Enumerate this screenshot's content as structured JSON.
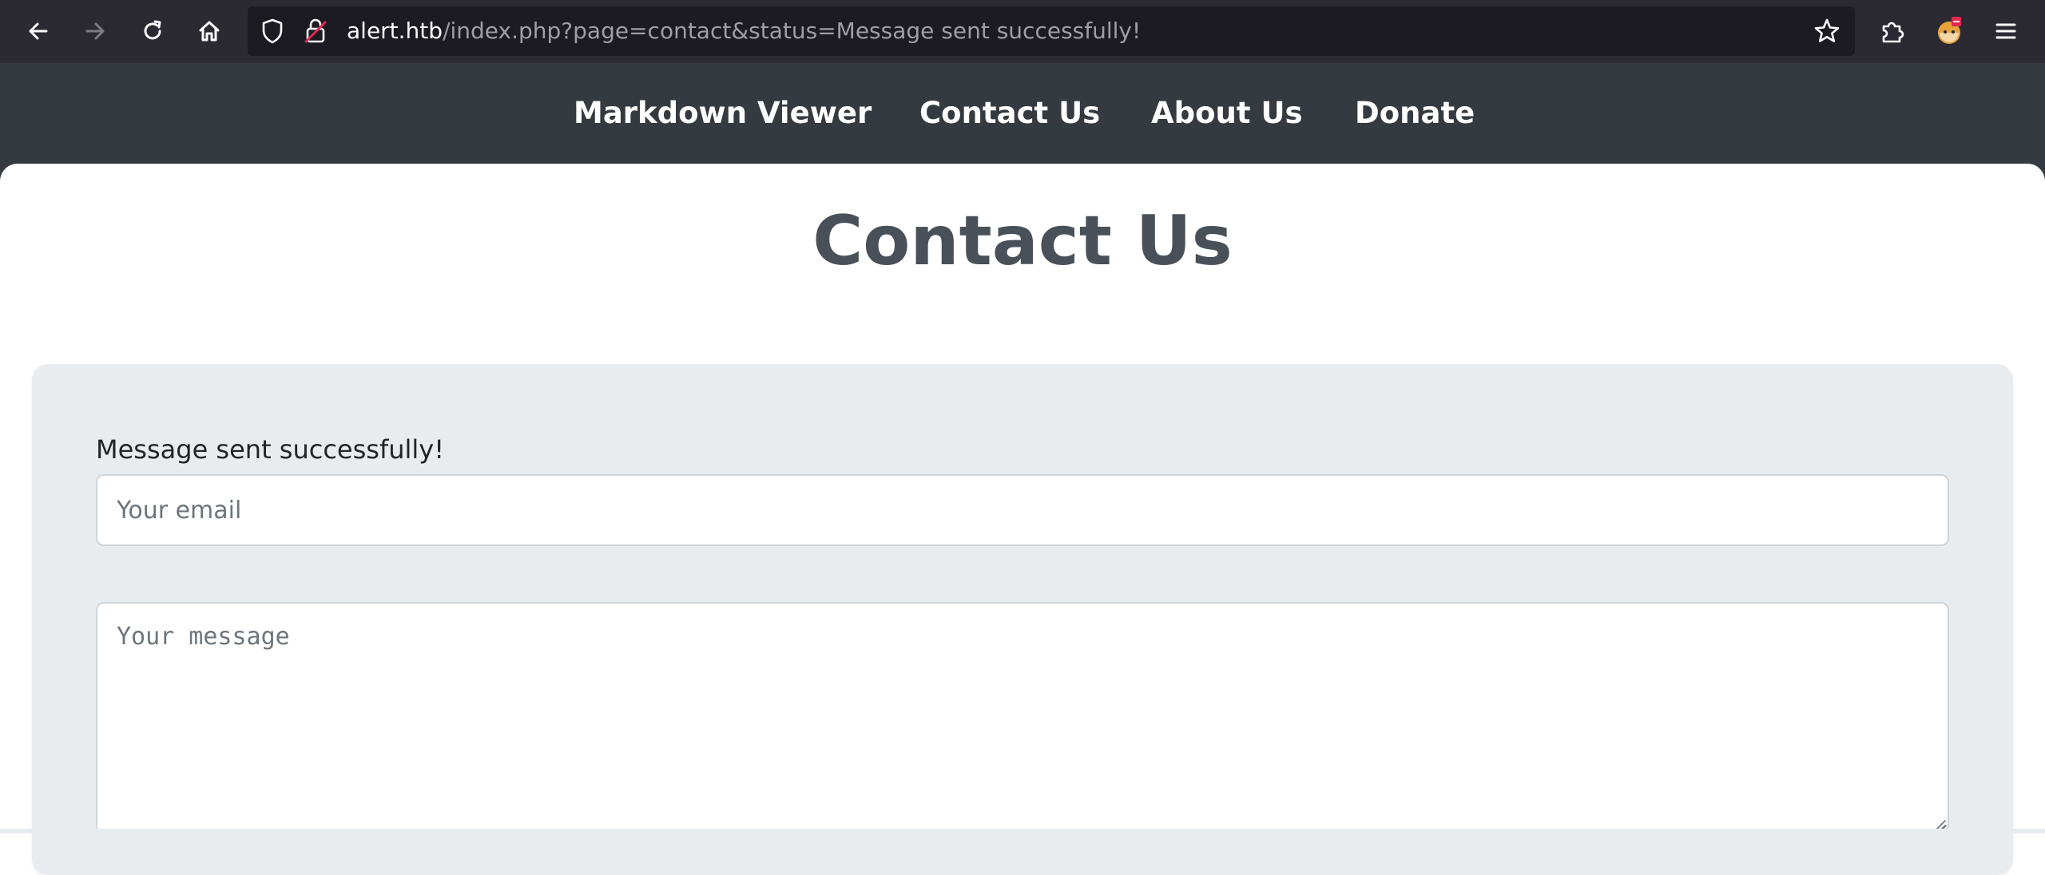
{
  "browser": {
    "url_host": "alert.htb",
    "url_path": "/index.php?page=contact&status=Message sent successfully!",
    "icons": [
      "back-arrow-icon",
      "forward-arrow-icon",
      "reload-icon",
      "home-icon",
      "shield-icon",
      "insecure-lock-icon",
      "bookmark-star-icon",
      "extensions-icon",
      "profile-avatar-icon",
      "hamburger-menu-icon"
    ]
  },
  "site_nav": {
    "items": [
      {
        "label": "Markdown Viewer"
      },
      {
        "label": "Contact Us"
      },
      {
        "label": "About Us"
      },
      {
        "label": "Donate"
      }
    ]
  },
  "main": {
    "title": "Contact Us",
    "status_message": "Message sent successfully!",
    "email_placeholder": "Your email",
    "message_placeholder": "Your message"
  },
  "colors": {
    "browser_bar": "#2b2a33",
    "url_field": "#1c1b22",
    "site_nav": "#343a40",
    "title": "#495057",
    "card": "#e9ecef"
  }
}
